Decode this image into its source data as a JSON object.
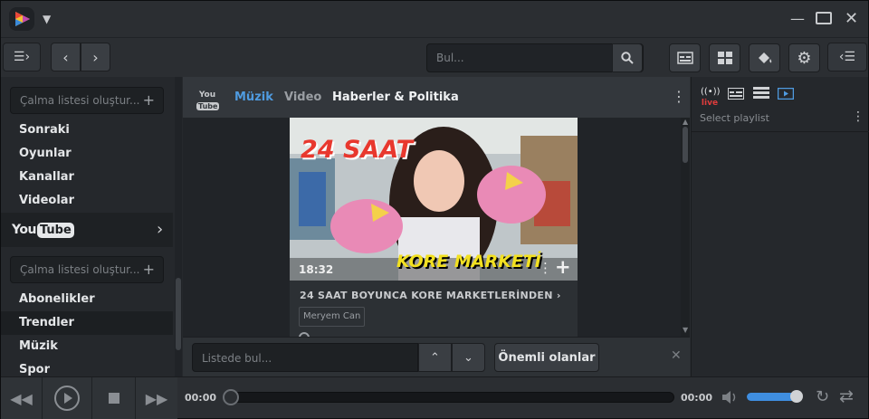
{
  "titlebar": {
    "icons": [
      "app-logo-icon",
      "chevron-down-icon",
      "minimize-icon",
      "maximize-icon",
      "close-icon"
    ]
  },
  "toolbar": {
    "search_placeholder": "Bul...",
    "icons": [
      "sidebar-toggle-icon",
      "back-icon",
      "forward-icon",
      "search-icon",
      "subtitle-icon",
      "grid-view-icon",
      "paint-bucket-icon",
      "gear-icon",
      "right-panel-toggle-icon"
    ]
  },
  "left_panel": {
    "playlist_placeholder_1": "Çalma listesi oluştur...",
    "items_top": [
      "Sonraki",
      "Oyunlar",
      "Kanallar",
      "Videolar"
    ],
    "youtube_label": "YouTube",
    "playlist_placeholder_2": "Çalma listesi oluştur...",
    "items_bottom": [
      "Abonelikler",
      "Trendler",
      "Müzik",
      "Spor"
    ],
    "selected": "Trendler"
  },
  "center": {
    "tabs": [
      "Müzik",
      "Video",
      "Haberler & Politika"
    ],
    "active_tab": "Müzik",
    "bold_tab": "Haberler & Politika",
    "card": {
      "thumb_title": "24 SAAT",
      "thumb_caption": "KORE MARKETİ",
      "duration": "18:32",
      "title": "24 SAAT BOYUNCA KORE MARKETLERİNDEN",
      "channel": "Meryem Can"
    },
    "find_placeholder": "Listede bul...",
    "important_button": "Önemli olanlar"
  },
  "right_panel": {
    "live_label": "live",
    "select_playlist": "Select playlist"
  },
  "player": {
    "time_current": "00:00",
    "time_total": "00:00",
    "progress": 0,
    "volume": 0.9
  },
  "colors": {
    "accent": "#4f9be0",
    "background": "#2a2d31",
    "live_red": "#e03c3c"
  }
}
